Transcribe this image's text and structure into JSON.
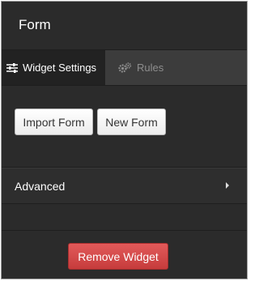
{
  "header": {
    "title": "Form"
  },
  "tabs": [
    {
      "label": "Widget Settings",
      "icon": "sliders-icon",
      "active": true
    },
    {
      "label": "Rules",
      "icon": "gears-icon",
      "active": false
    }
  ],
  "form_buttons": {
    "import_label": "Import Form",
    "new_label": "New Form"
  },
  "advanced": {
    "label": "Advanced",
    "icon": "chevron-right-icon"
  },
  "footer": {
    "remove_label": "Remove Widget"
  },
  "colors": {
    "panel_bg": "#2b2b2b",
    "tab_bar_bg": "#3c3c3c",
    "active_tab_bg": "#222222",
    "remove_button": "#d64b4b"
  }
}
